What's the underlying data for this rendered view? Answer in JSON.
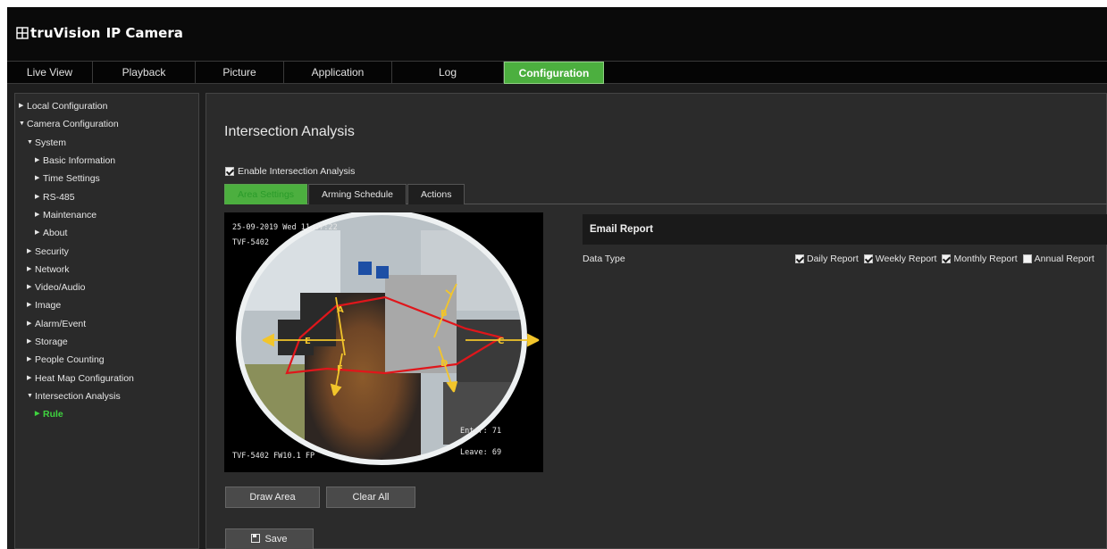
{
  "app": {
    "brand": "truVision",
    "brand_suffix": "IP Camera"
  },
  "nav": {
    "tabs": [
      {
        "label": "Live View",
        "active": false
      },
      {
        "label": "Playback",
        "active": false
      },
      {
        "label": "Picture",
        "active": false
      },
      {
        "label": "Application",
        "active": false
      },
      {
        "label": "Log",
        "active": false
      },
      {
        "label": "Configuration",
        "active": true
      }
    ]
  },
  "sidebar": {
    "items": [
      {
        "label": "Local Configuration",
        "expanded": false
      },
      {
        "label": "Camera Configuration",
        "expanded": true
      },
      {
        "label": "System",
        "expanded": true
      },
      {
        "label": "Basic Information",
        "expanded": false
      },
      {
        "label": "Time Settings",
        "expanded": false
      },
      {
        "label": "RS-485",
        "expanded": false
      },
      {
        "label": "Maintenance",
        "expanded": false
      },
      {
        "label": "About",
        "expanded": false
      },
      {
        "label": "Security",
        "expanded": false
      },
      {
        "label": "Network",
        "expanded": false
      },
      {
        "label": "Video/Audio",
        "expanded": false
      },
      {
        "label": "Image",
        "expanded": false
      },
      {
        "label": "Alarm/Event",
        "expanded": false
      },
      {
        "label": "Storage",
        "expanded": false
      },
      {
        "label": "People Counting",
        "expanded": false
      },
      {
        "label": "Heat Map Configuration",
        "expanded": false
      },
      {
        "label": "Intersection Analysis",
        "expanded": true
      },
      {
        "label": "Rule",
        "expanded": false,
        "active": true
      }
    ]
  },
  "main": {
    "title": "Intersection Analysis",
    "enable_label": "Enable Intersection Analysis",
    "enable_checked": true,
    "tabs": [
      {
        "label": "Area Settings",
        "active": true
      },
      {
        "label": "Arming Schedule",
        "active": false
      },
      {
        "label": "Actions",
        "active": false
      }
    ],
    "video": {
      "timestamp": "25-09-2019 Wed 11:07:22",
      "camera_name": "TVF-5402",
      "firmware": "TVF-5402 FW10.1 FP",
      "enter_text": "Enter: 71",
      "leave_text": "Leave: 69",
      "area_labels": [
        "A",
        "B",
        "C",
        "D",
        "E",
        "F"
      ]
    },
    "email_report": {
      "title": "Email Report",
      "data_type_label": "Data Type",
      "options": [
        {
          "label": "Daily Report",
          "checked": true
        },
        {
          "label": "Weekly Report",
          "checked": true
        },
        {
          "label": "Monthly Report",
          "checked": true
        },
        {
          "label": "Annual Report",
          "checked": false
        }
      ]
    },
    "buttons": {
      "draw_area": "Draw Area",
      "clear_all": "Clear All",
      "save": "Save"
    }
  },
  "colors": {
    "accent": "#4caf3f",
    "active_text": "#3fd43f",
    "overlay_red": "#e0161b",
    "overlay_yellow": "#f2c52b"
  }
}
